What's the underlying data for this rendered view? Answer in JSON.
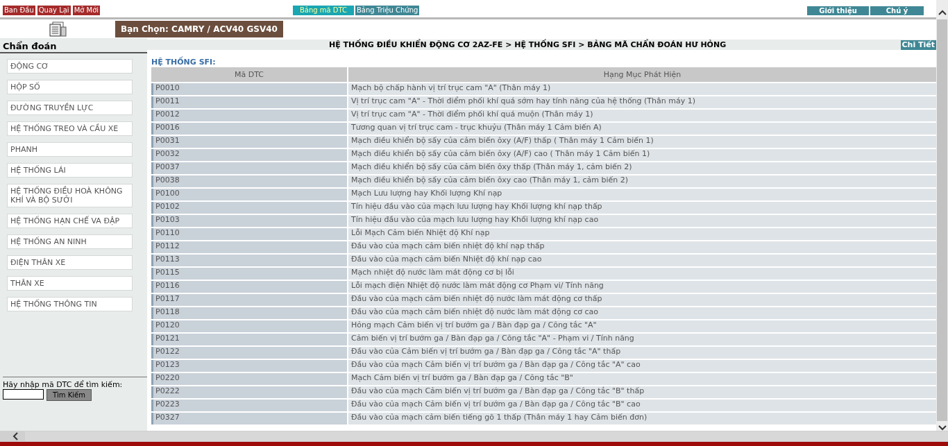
{
  "top_nav": {
    "buttons": [
      "Ban Đầu",
      "Quay Lại",
      "Mở Mới"
    ],
    "tabs": [
      {
        "label": "Bảng mã DTC",
        "selected": true
      },
      {
        "label": "Bảng Triệu Chứng",
        "selected": false
      }
    ],
    "links": [
      "Giới thiệu",
      "Chú ý"
    ]
  },
  "selection": "Bạn Chọn: CAMRY / ACV40 GSV40",
  "breadcrumb": "HỆ THỐNG ĐIỀU KHIỂN ĐỘNG CƠ 2AZ-FE > HỆ THỐNG SFI > BẢNG MÃ CHẨN ĐOÁN HƯ HỎNG",
  "detail_button": "Chi Tiết",
  "sidebar": {
    "title": "Chẩn đoán",
    "items": [
      "ĐỘNG CƠ",
      "HỘP SỐ",
      "ĐƯỜNG TRUYỀN LỰC",
      "HỆ THỐNG TREO VÀ CẦU XE",
      "PHANH",
      "HỆ THỐNG LÁI",
      "HỆ THỐNG ĐIỀU HOÀ KHÔNG KHÍ VÀ BỘ SƯỞI",
      "HỆ THỐNG HẠN CHẾ VA ĐẬP",
      "HỆ THỐNG AN NINH",
      "ĐIỆN THÂN XE",
      "THÂN XE",
      "HỆ THỐNG THÔNG TIN"
    ],
    "search_label": "Hãy nhập mã DTC để tìm kiếm:",
    "search_button": "Tìm Kiếm"
  },
  "section_title": "HỆ THỐNG SFI:",
  "table": {
    "columns": [
      "Mã DTC",
      "Hạng Mục Phát Hiện"
    ],
    "rows": [
      [
        "P0010",
        "Mạch bộ chấp hành vị trí trục cam \"A\" (Thân máy 1)"
      ],
      [
        "P0011",
        "Vị trí trục cam \"A\" - Thời điểm phối khí quá sớm hay tính năng của hệ thống (Thân máy 1)"
      ],
      [
        "P0012",
        "Vị trí trục cam \"A\" - Thời điểm phối khí quá muộn (Thân máy 1)"
      ],
      [
        "P0016",
        "Tương quan vị trí trục cam - trục khuỷu (Thân máy 1 Cảm biến A)"
      ],
      [
        "P0031",
        "Mạch điều khiển bộ sấy của cảm biến ôxy (A/F) thấp ( Thân máy 1 Cảm biến 1)"
      ],
      [
        "P0032",
        "Mạch điều khiển bộ sấy của cảm biến ôxy (A/F) cao ( Thân máy 1 Cảm biến 1)"
      ],
      [
        "P0037",
        "Mạch điều khiển bộ sấy của cảm biến ôxy thấp (Thân máy 1, cảm biến 2)"
      ],
      [
        "P0038",
        "Mạch điều khiển bộ sấy của cảm biến ôxy cao (Thân máy 1, cảm biến 2)"
      ],
      [
        "P0100",
        "Mạch Lưu lượng hay Khối lượng Khí nạp"
      ],
      [
        "P0102",
        "Tín hiệu đầu vào của mạch lưu lượng hay Khối lượng khí nạp thấp"
      ],
      [
        "P0103",
        "Tín hiệu đầu vào của mạch lưu lượng hay Khối lượng khí nạp cao"
      ],
      [
        "P0110",
        "Lỗi Mạch Cảm biến Nhiệt độ Khí nạp"
      ],
      [
        "P0112",
        "Đầu vào của mạch cảm biến nhiệt độ khí nạp thấp"
      ],
      [
        "P0113",
        "Đầu vào của mạch cảm biến Nhiệt độ khí nạp cao"
      ],
      [
        "P0115",
        "Mạch nhiệt độ nước làm mát động cơ bị lỗi"
      ],
      [
        "P0116",
        "Lỗi mạch điện Nhiệt độ nước làm mát động cơ Phạm vi/ Tính năng"
      ],
      [
        "P0117",
        "Đầu vào của mạch cảm biến nhiệt độ nước làm mát động cơ thấp"
      ],
      [
        "P0118",
        "Đầu vào của mạch cảm biến nhiệt độ nước làm mát động cơ cao"
      ],
      [
        "P0120",
        "Hỏng mạch Cảm biến vị trí bướm ga / Bàn đạp ga / Công tắc \"A\""
      ],
      [
        "P0121",
        "Cảm biến vị trí bướm ga / Bàn đạp ga / Công tắc \"A\" - Phạm vi / Tính năng"
      ],
      [
        "P0122",
        "Đầu vào của Cảm biến vị trí bướm ga / Bàn đạp ga / Công tắc \"A\" thấp"
      ],
      [
        "P0123",
        "Đầu vào của mạch Cảm biến vị trí bướm ga / Bàn đạp ga / Công tắc \"A\" cao"
      ],
      [
        "P0220",
        "Mạch Cảm biến vị trí bướm ga / Bàn đạp ga / Công tắc \"B\""
      ],
      [
        "P0222",
        "Đầu vào của mạch Cảm biến vị trí bướm ga / Bàn đạp ga / Công tắc \"B\" thấp"
      ],
      [
        "P0223",
        "Đầu vào của mạch Cảm biến vị trí bướm ga / Bàn đạp ga / Công tắc \"B\" cao"
      ],
      [
        "P0327",
        "Đầu vào của mạch cảm biến tiếng gõ 1 thấp (Thân máy 1 hay Cảm biến đơn)"
      ]
    ]
  }
}
